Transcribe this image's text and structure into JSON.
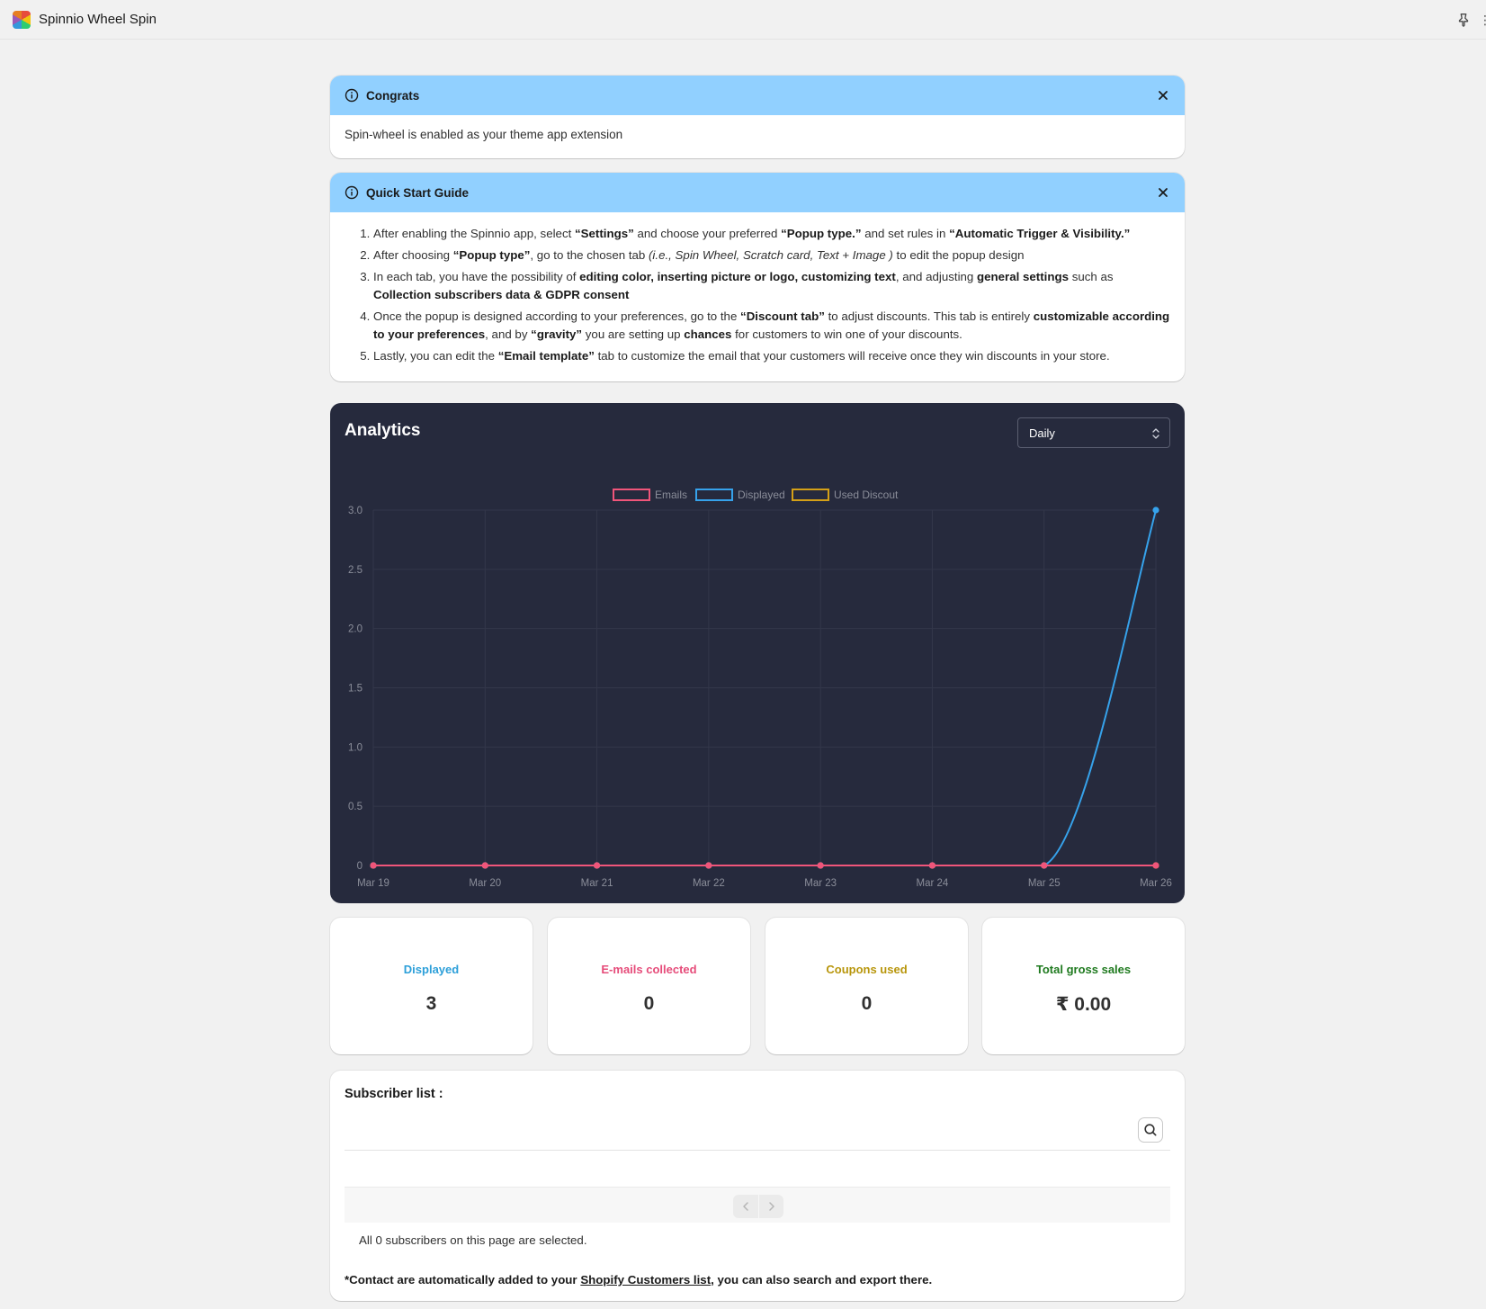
{
  "app": {
    "title": "Spinnio Wheel Spin"
  },
  "congrats": {
    "title": "Congrats",
    "message": "Spin-wheel is enabled as your theme app extension"
  },
  "guide": {
    "title": "Quick Start Guide",
    "items": [
      [
        {
          "t": "After enabling the Spinnio app, select "
        },
        {
          "t": "“Settings”",
          "b": true
        },
        {
          "t": " and choose your preferred "
        },
        {
          "t": "“Popup type.”",
          "b": true
        },
        {
          "t": " and set rules in "
        },
        {
          "t": "“Automatic Trigger & Visibility.”",
          "b": true
        }
      ],
      [
        {
          "t": "After choosing "
        },
        {
          "t": "“Popup type”",
          "b": true
        },
        {
          "t": ", go to the chosen tab "
        },
        {
          "t": "(i.e., Spin Wheel, Scratch card, Text + Image )",
          "i": true
        },
        {
          "t": " to edit the popup design"
        }
      ],
      [
        {
          "t": "In each tab, you have the possibility of "
        },
        {
          "t": "editing color, inserting picture or logo, customizing text",
          "b": true
        },
        {
          "t": ", and adjusting "
        },
        {
          "t": "general settings",
          "b": true
        },
        {
          "t": " such as "
        },
        {
          "t": "Collection subscribers data & GDPR consent",
          "b": true
        }
      ],
      [
        {
          "t": "Once the popup is designed according to your preferences, go to the "
        },
        {
          "t": "“Discount tab”",
          "b": true
        },
        {
          "t": " to adjust discounts. This tab is entirely "
        },
        {
          "t": "customizable according to your preferences",
          "b": true
        },
        {
          "t": ", and by "
        },
        {
          "t": "“gravity”",
          "b": true
        },
        {
          "t": " you are setting up "
        },
        {
          "t": "chances",
          "b": true
        },
        {
          "t": " for customers to win one of your discounts."
        }
      ],
      [
        {
          "t": "Lastly, you can edit the "
        },
        {
          "t": "“Email template”",
          "b": true
        },
        {
          "t": " tab to customize the email that your customers will receive once they win discounts in your store."
        }
      ]
    ]
  },
  "analytics": {
    "title": "Analytics",
    "period_select": "Daily"
  },
  "chart_data": {
    "type": "line",
    "x": [
      "Mar 19",
      "Mar 20",
      "Mar 21",
      "Mar 22",
      "Mar 23",
      "Mar 24",
      "Mar 25",
      "Mar 26"
    ],
    "series": [
      {
        "name": "Emails",
        "color": "#f0557a",
        "values": [
          0,
          0,
          0,
          0,
          0,
          0,
          0,
          0
        ]
      },
      {
        "name": "Displayed",
        "color": "#36a2eb",
        "values": [
          0,
          0,
          0,
          0,
          0,
          0,
          0,
          3
        ]
      },
      {
        "name": "Used Discout",
        "color": "#d4a017",
        "values": [
          0,
          0,
          0,
          0,
          0,
          0,
          0,
          0
        ]
      }
    ],
    "ylim": [
      0,
      3
    ],
    "yticks": [
      "0",
      "0.5",
      "1.0",
      "1.5",
      "2.0",
      "2.5",
      "3.0"
    ],
    "legend": "top-center",
    "grid": true
  },
  "stats": [
    {
      "label": "Displayed",
      "value": "3",
      "color": "#2c9fd9"
    },
    {
      "label": "E-mails collected",
      "value": "0",
      "color": "#e64c7a"
    },
    {
      "label": "Coupons used",
      "value": "0",
      "color": "#b8960c"
    },
    {
      "label": "Total gross sales",
      "value": "₹ 0.00",
      "color": "#1f7a1f"
    }
  ],
  "subscribers": {
    "title": "Subscriber list :",
    "selected_text": "All 0 subscribers on this page are selected.",
    "note_prefix": "*Contact are automatically added to your ",
    "note_link": "Shopify Customers list",
    "note_suffix": ", you can also search and export there."
  }
}
